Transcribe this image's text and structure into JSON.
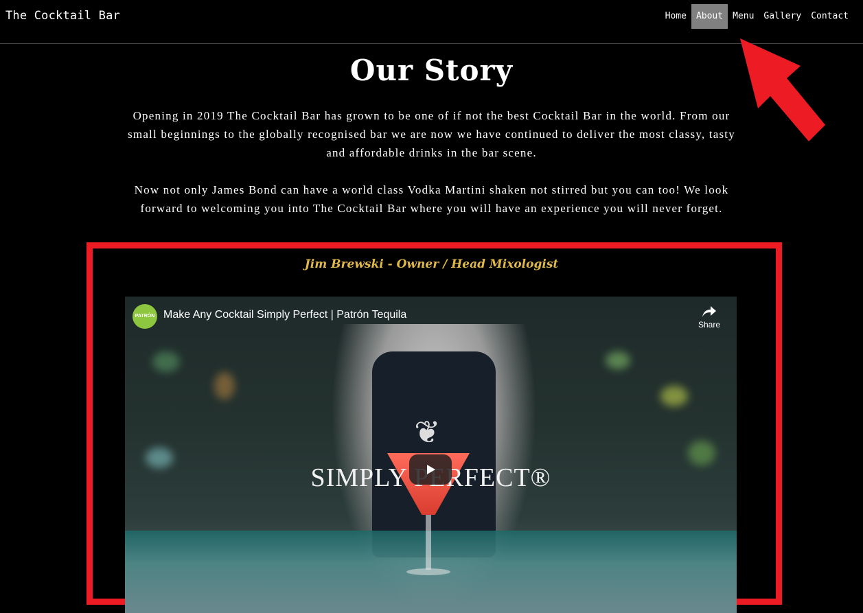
{
  "site": {
    "brand": "The Cocktail Bar"
  },
  "nav": {
    "items": [
      {
        "label": "Home",
        "active": false
      },
      {
        "label": "About",
        "active": true
      },
      {
        "label": "Menu",
        "active": false
      },
      {
        "label": "Gallery",
        "active": false
      },
      {
        "label": "Contact",
        "active": false
      }
    ]
  },
  "page": {
    "title": "Our Story",
    "paragraphs": [
      "Opening in 2019 The Cocktail Bar has grown to be one of if not the best Cocktail Bar in the world. From our small beginnings to the globally recognised bar we are now we have continued to deliver the most classy, tasty and affordable drinks in the bar scene.",
      "Now not only James Bond can have a world class Vodka Martini shaken not stirred but you can too! We look forward to welcoming you into The Cocktail Bar where you will have an experience you will never forget."
    ],
    "owner_caption": "Jim Brewski - Owner / Head Mixologist"
  },
  "video": {
    "title": "Make Any Cocktail Simply Perfect | Patrón Tequila",
    "channel_avatar_text": "PATRÓN",
    "share_label": "Share",
    "wordmark": "SIMPLY PERFECT®"
  },
  "colors": {
    "highlight": "#ed1c24",
    "caption": "#e0b84a",
    "active_nav": "#808080"
  },
  "icons": [
    "share-icon",
    "play-icon",
    "bee-logo-icon",
    "arrow-icon"
  ]
}
